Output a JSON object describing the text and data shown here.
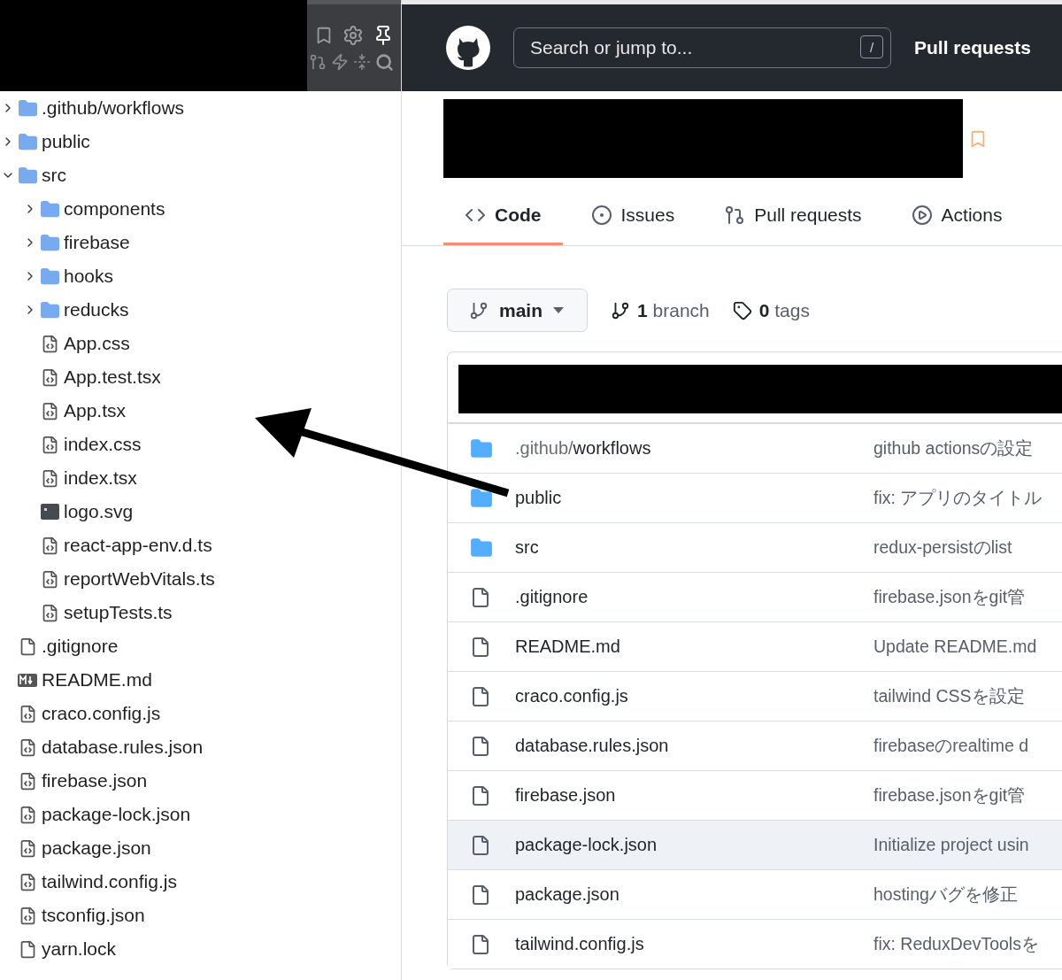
{
  "file_tree": [
    {
      "name": ".github/workflows",
      "kind": "folder",
      "expanded": false
    },
    {
      "name": "public",
      "kind": "folder",
      "expanded": false
    },
    {
      "name": "src",
      "kind": "folder",
      "expanded": true,
      "children": [
        {
          "name": "components",
          "kind": "folder",
          "expanded": false
        },
        {
          "name": "firebase",
          "kind": "folder",
          "expanded": false
        },
        {
          "name": "hooks",
          "kind": "folder",
          "expanded": false
        },
        {
          "name": "reducks",
          "kind": "folder",
          "expanded": false
        },
        {
          "name": "App.css",
          "kind": "code"
        },
        {
          "name": "App.test.tsx",
          "kind": "code"
        },
        {
          "name": "App.tsx",
          "kind": "code"
        },
        {
          "name": "index.css",
          "kind": "code"
        },
        {
          "name": "index.tsx",
          "kind": "code"
        },
        {
          "name": "logo.svg",
          "kind": "image"
        },
        {
          "name": "react-app-env.d.ts",
          "kind": "code"
        },
        {
          "name": "reportWebVitals.ts",
          "kind": "code"
        },
        {
          "name": "setupTests.ts",
          "kind": "code"
        }
      ]
    },
    {
      "name": ".gitignore",
      "kind": "file"
    },
    {
      "name": "README.md",
      "kind": "markdown"
    },
    {
      "name": "craco.config.js",
      "kind": "code"
    },
    {
      "name": "database.rules.json",
      "kind": "code"
    },
    {
      "name": "firebase.json",
      "kind": "code"
    },
    {
      "name": "package-lock.json",
      "kind": "code"
    },
    {
      "name": "package.json",
      "kind": "code"
    },
    {
      "name": "tailwind.config.js",
      "kind": "code"
    },
    {
      "name": "tsconfig.json",
      "kind": "code"
    },
    {
      "name": "yarn.lock",
      "kind": "file"
    }
  ],
  "header": {
    "search": {
      "placeholder": "Search or jump to...",
      "shortcut": "/"
    },
    "nav_links": [
      "Pull requests"
    ]
  },
  "repo_tabs": [
    {
      "label": "Code",
      "kind": "code",
      "selected": true
    },
    {
      "label": "Issues",
      "kind": "issue",
      "selected": false
    },
    {
      "label": "Pull requests",
      "kind": "pull",
      "selected": false
    },
    {
      "label": "Actions",
      "kind": "play",
      "selected": false
    }
  ],
  "branch_selector": {
    "branch": "main"
  },
  "branch_count": "**1** branch",
  "tag_count": "**0** tags",
  "files": [
    {
      "kind": "folder",
      "prefix": ".github/",
      "name": "workflows",
      "message": "github actionsの設定",
      "highlighted": false
    },
    {
      "kind": "folder",
      "name": "public",
      "message": "fix: アプリのタイトル",
      "highlighted": false
    },
    {
      "kind": "folder",
      "name": "src",
      "message": "redux-persistのlist",
      "highlighted": false
    },
    {
      "kind": "file",
      "name": ".gitignore",
      "message": "firebase.jsonをgit管",
      "highlighted": false
    },
    {
      "kind": "file",
      "name": "README.md",
      "message": "Update README.md",
      "highlighted": false
    },
    {
      "kind": "file",
      "name": "craco.config.js",
      "message": "tailwind CSSを設定",
      "highlighted": false
    },
    {
      "kind": "file",
      "name": "database.rules.json",
      "message": "firebaseのrealtime d",
      "highlighted": false
    },
    {
      "kind": "file",
      "name": "firebase.json",
      "message": "firebase.jsonをgit管",
      "highlighted": false
    },
    {
      "kind": "file",
      "name": "package-lock.json",
      "message": "Initialize project usin",
      "highlighted": true
    },
    {
      "kind": "file",
      "name": "package.json",
      "message": "hostingバグを修正",
      "highlighted": false
    },
    {
      "kind": "file",
      "name": "tailwind.config.js",
      "message": "fix: ReduxDevToolsを",
      "highlighted": false
    }
  ]
}
